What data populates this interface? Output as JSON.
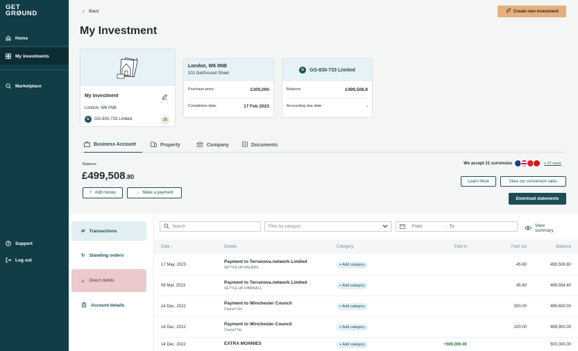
{
  "logo": {
    "line1": "GET",
    "line2": "GRØUND"
  },
  "sidebar": {
    "items": [
      {
        "label": "Home"
      },
      {
        "label": "My investments"
      },
      {
        "label": "Marketplace"
      }
    ],
    "bottom": [
      {
        "label": "Support"
      },
      {
        "label": "Log out"
      }
    ]
  },
  "header": {
    "back": "Back",
    "create": "Create new investment",
    "title": "My Investment"
  },
  "investment": {
    "name": "My Investment",
    "address": "London, W6 0NB",
    "company": "GG-830-733 Limited",
    "initials": "JS"
  },
  "property": {
    "title": "London, W6 0NB",
    "street": "101 GetGround Street",
    "price_label": "Purchase price:",
    "price": "£300,000",
    "completion_label": "Completion date:",
    "completion": "17 Feb 2023"
  },
  "company": {
    "title": "GG-830-733 Limited",
    "balance_label": "Balance:",
    "balance": "£499,508.8",
    "due_label": "Accounting due date:",
    "due": "-"
  },
  "tabs": [
    {
      "label": "Business Account"
    },
    {
      "label": "Property"
    },
    {
      "label": "Company"
    },
    {
      "label": "Documents"
    }
  ],
  "account": {
    "balance_label": "Balance",
    "balance_main": "£499,508",
    "balance_dec": ".80",
    "add_money": "Add money",
    "make_payment": "Make a payment",
    "accept": "We accept 31 currencies",
    "more": "+ 27 more",
    "learn_more": "Learn More",
    "rates": "View our conversion rates",
    "download": "Download statements"
  },
  "menu": [
    {
      "label": "Transactions"
    },
    {
      "label": "Standing orders"
    },
    {
      "label": "Direct debits"
    },
    {
      "label": "Account details"
    }
  ],
  "filters": {
    "search": "Search",
    "category": "Filter by category",
    "from": "From:",
    "dash": "-",
    "to": "To:",
    "summary": "View summary"
  },
  "table": {
    "headers": {
      "date": "Date",
      "details": "Details",
      "category": "Category",
      "paid_in": "Paid in",
      "paid_out": "Paid out",
      "balance": "Balance"
    },
    "rows": [
      {
        "date": "17 May, 2023",
        "title": "Payment to Terranova.network Limited",
        "ref": "SETTLE-UP-k6qJhf2n",
        "category": "+ Add category",
        "paid_in": "",
        "paid_out": "45.60",
        "balance": "499,508.80"
      },
      {
        "date": "08 Mar, 2023",
        "title": "Payment to Terranova.network Limited",
        "ref": "SETTLE-UP-tVBMSACL",
        "category": "+ Add category",
        "paid_in": "",
        "paid_out": "45.60",
        "balance": "499,554.40"
      },
      {
        "date": "14 Dec, 2022",
        "title": "Payment to Winchester Council",
        "ref": "Council Tax",
        "category": "+ Add category",
        "paid_in": "",
        "paid_out": "300.00",
        "balance": "499,600.00"
      },
      {
        "date": "14 Dec, 2022",
        "title": "Payment to Winchester Council",
        "ref": "Council Tax",
        "category": "+ Add category",
        "paid_in": "",
        "paid_out": "100.00",
        "balance": "499,900.00"
      },
      {
        "date": "14 Dec, 2022",
        "title": "EXTRA MONNIES",
        "ref": "",
        "category": "+ Add category",
        "paid_in": "+500,000.00",
        "paid_out": "",
        "balance": "500,000.00"
      }
    ]
  }
}
